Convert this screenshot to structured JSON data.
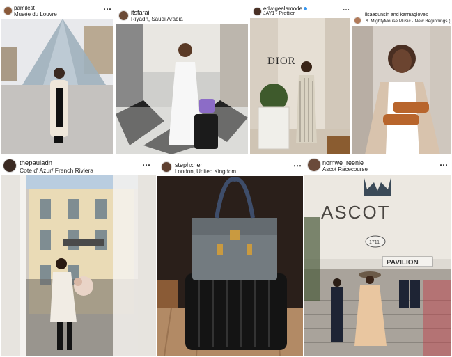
{
  "posts": [
    {
      "username": "pamilest",
      "location": "Musée du Louvre",
      "more": "⋯",
      "avatar": "avatar"
    },
    {
      "username": "itsfarai",
      "location": "Riyadh, Saudi Arabia",
      "more": "⋯",
      "avatar": "avatar"
    },
    {
      "username": "edwigealamode",
      "verified": true,
      "location": "JAY1 · Prettier",
      "more": "⋯",
      "avatar": "avatar"
    },
    {
      "username": "lisaedunsin and karmagloves",
      "location": "♬ MightyMouse Music · New Beginnings (re",
      "more": "",
      "avatar": "avatar"
    },
    {
      "username": "thepauladn",
      "location": "Cote d' Azur/ French Riviera",
      "more": "⋯",
      "avatar": "avatar"
    },
    {
      "username": "stephxher",
      "location": "London, United Kingdom",
      "more": "⋯",
      "avatar": "avatar"
    },
    {
      "username": "nomwe_reenie",
      "location": "Ascot Racecourse",
      "more": "⋯",
      "avatar": "avatar"
    }
  ],
  "photo_text": {
    "dior_sign": "DIOR",
    "ascot_sign": "ASCOT",
    "ascot_year": "1711",
    "pavilion_sign": "PAVILION"
  },
  "colors": {
    "accent_verified": "#3897f0",
    "text": "#111111"
  }
}
